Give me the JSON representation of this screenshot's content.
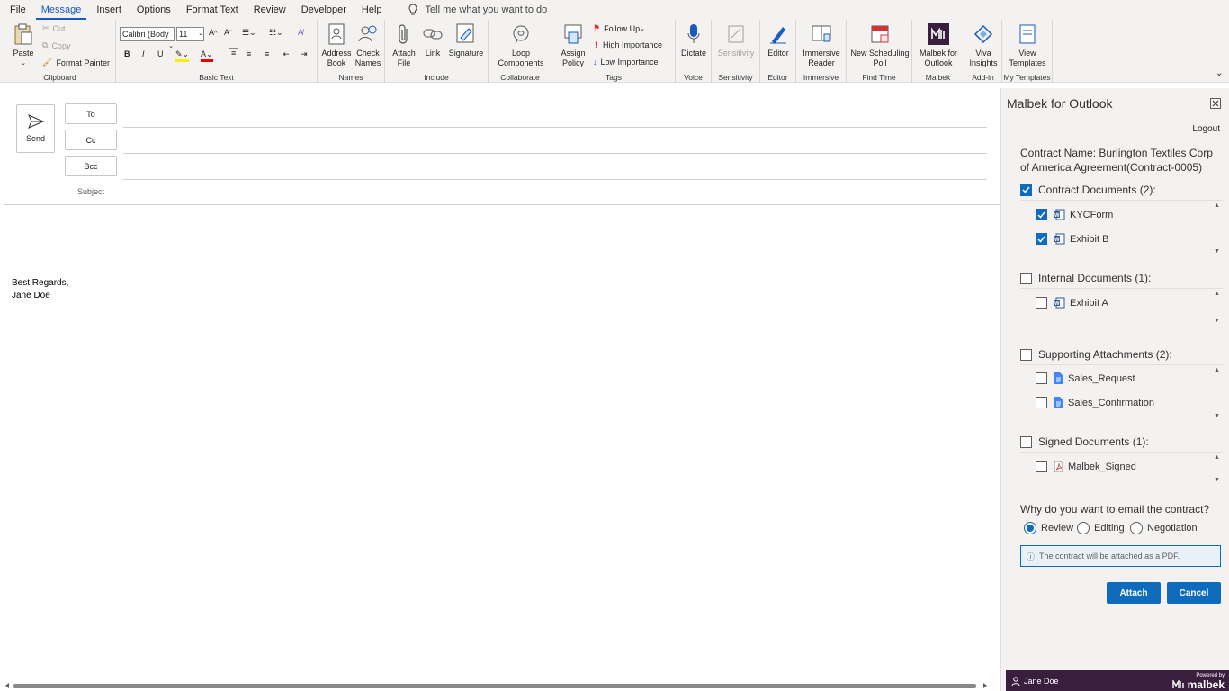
{
  "menu": {
    "tabs": [
      "File",
      "Message",
      "Insert",
      "Options",
      "Format Text",
      "Review",
      "Developer",
      "Help"
    ],
    "active": 1,
    "tell_me": "Tell me what you want to do"
  },
  "ribbon": {
    "clipboard": {
      "paste": "Paste",
      "cut": "Cut",
      "copy": "Copy",
      "format_painter": "Format Painter",
      "label": "Clipboard"
    },
    "basic_text": {
      "font": "Calibri (Body",
      "size": "11",
      "label": "Basic Text"
    },
    "names": {
      "address_book": "Address Book",
      "check_names": "Check Names",
      "label": "Names"
    },
    "include": {
      "attach_file": "Attach File",
      "link": "Link",
      "signature": "Signature",
      "label": "Include"
    },
    "collaborate": {
      "loop": "Loop Components",
      "label": "Collaborate"
    },
    "tags": {
      "assign_policy": "Assign Policy",
      "follow_up": "Follow Up",
      "high": "High Importance",
      "low": "Low Importance",
      "label": "Tags"
    },
    "voice": {
      "dictate": "Dictate",
      "label": "Voice"
    },
    "sensitivity": {
      "btn": "Sensitivity",
      "label": "Sensitivity"
    },
    "editor": {
      "btn": "Editor",
      "label": "Editor"
    },
    "immersive": {
      "btn": "Immersive Reader",
      "label": "Immersive"
    },
    "find_time": {
      "btn": "New Scheduling Poll",
      "label": "Find Time"
    },
    "malbek": {
      "btn": "Malbek for Outlook",
      "label": "Malbek"
    },
    "addin": {
      "btn": "Viva Insights",
      "label": "Add-in"
    },
    "templates": {
      "btn": "View Templates",
      "label": "My Templates"
    }
  },
  "compose": {
    "send": "Send",
    "to": "To",
    "cc": "Cc",
    "bcc": "Bcc",
    "subject": "Subject",
    "body_line1": "Best Regards,",
    "body_line2": "Jane Doe"
  },
  "pane": {
    "title": "Malbek for Outlook",
    "logout": "Logout",
    "contract_name": "Contract Name: Burlington Textiles Corp of America Agreement(Contract-0005)",
    "sections": [
      {
        "title": "Contract Documents (2):",
        "checked": true,
        "items": [
          {
            "name": "KYCForm",
            "checked": true,
            "icon": "word-icon"
          },
          {
            "name": "Exhibit B",
            "checked": true,
            "icon": "word-icon"
          }
        ]
      },
      {
        "title": "Internal Documents (1):",
        "checked": false,
        "items": [
          {
            "name": "Exhibit A",
            "checked": false,
            "icon": "word-icon"
          }
        ]
      },
      {
        "title": "Supporting Attachments (2):",
        "checked": false,
        "items": [
          {
            "name": "Sales_Request",
            "checked": false,
            "icon": "doc-icon"
          },
          {
            "name": "Sales_Confirmation",
            "checked": false,
            "icon": "doc-icon"
          }
        ]
      },
      {
        "title": "Signed Documents (1):",
        "checked": false,
        "items": [
          {
            "name": "Malbek_Signed",
            "checked": false,
            "icon": "pdf-icon"
          }
        ]
      }
    ],
    "why": "Why do you want to email the contract?",
    "reasons": [
      "Review",
      "Editing",
      "Negotiation"
    ],
    "selected_reason": "Review",
    "info": "The contract will be attached as a PDF.",
    "attach": "Attach",
    "cancel": "Cancel",
    "user": "Jane Doe",
    "powered_by": "Powered by",
    "brand": "malbek"
  },
  "colors": {
    "accent": "#0f6cbd",
    "brand": "#3a1e3e"
  }
}
